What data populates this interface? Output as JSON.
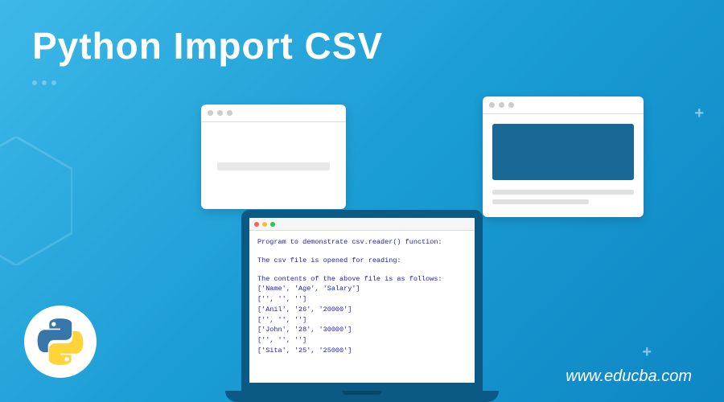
{
  "title": "Python Import CSV",
  "brand": "www.educba.com",
  "code": {
    "line1": "Program to demonstrate csv.reader() function:",
    "line2": "The csv file is opened for reading:",
    "line3": "The contents of the above file is as follows:",
    "row1": "['Name', 'Age', 'Salary']",
    "row2": "['', '', '']",
    "row3": "['Anil', '26', '20000']",
    "row4": "['', '', '']",
    "row5": "['John', '28', '30000']",
    "row6": "['', '', '']",
    "row7": "['Sita', '25', '25000']"
  }
}
